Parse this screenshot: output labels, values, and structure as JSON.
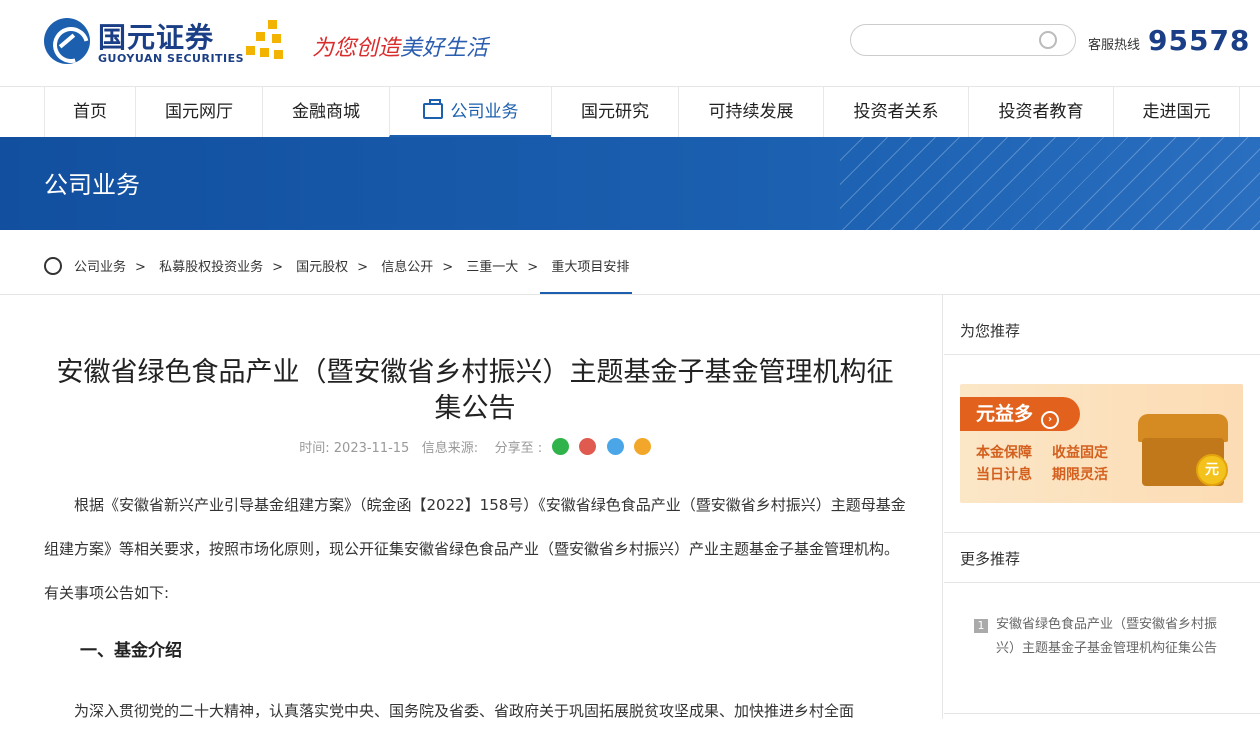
{
  "brand": {
    "name_cn": "国元证券",
    "name_en": "GUOYUAN SECURITIES",
    "slogan_part1": "为您创造",
    "slogan_part2": "美好生活"
  },
  "header": {
    "search_placeholder": "",
    "hotline_label": "客服热线",
    "hotline_number": "95578"
  },
  "nav": [
    {
      "label": "首页"
    },
    {
      "label": "国元网厅"
    },
    {
      "label": "金融商城"
    },
    {
      "label": "公司业务"
    },
    {
      "label": "国元研究"
    },
    {
      "label": "可持续发展"
    },
    {
      "label": "投资者关系"
    },
    {
      "label": "投资者教育"
    },
    {
      "label": "走进国元"
    }
  ],
  "banner": {
    "title": "公司业务"
  },
  "breadcrumb": [
    "公司业务",
    "私募股权投资业务",
    "国元股权",
    "信息公开",
    "三重一大",
    "重大项目安排"
  ],
  "article": {
    "title": "安徽省绿色食品产业（暨安徽省乡村振兴）主题基金子基金管理机构征集公告",
    "time": "时间: 2023-11-15",
    "source": "信息来源:",
    "share": "分享至 :",
    "para1": "根据《安徽省新兴产业引导基金组建方案》（皖金函【2022】158号）《安徽省绿色食品产业（暨安徽省乡村振兴）主题母基金组建方案》等相关要求，按照市场化原则，现公开征集安徽省绿色食品产业（暨安徽省乡村振兴）产业主题基金子基金管理机构。有关事项公告如下:",
    "heading1": "一、基金介绍",
    "para2": "为深入贯彻党的二十大精神，认真落实党中央、国务院及省委、省政府关于巩固拓展脱贫攻坚成果、加快推进乡村全面"
  },
  "side": {
    "rec_title": "为您推荐",
    "promo": {
      "tag": "元益多",
      "line1a": "本金保障",
      "line1b": "收益固定",
      "line2a": "当日计息",
      "line2b": "期限灵活",
      "coin": "元"
    },
    "more_title": "更多推荐",
    "items": [
      {
        "num": "1",
        "text": "安徽省绿色食品产业（暨安徽省乡村振兴）主题基金子基金管理机构征集公告"
      }
    ]
  }
}
